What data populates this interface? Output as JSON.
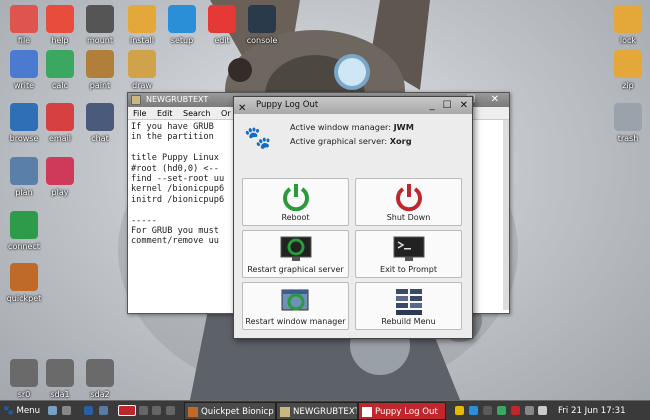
{
  "desktop": {
    "icons": [
      {
        "label": "file",
        "icon": "folder-icon",
        "color": "#e0544f"
      },
      {
        "label": "help",
        "icon": "lifebuoy-icon",
        "color": "#e74c3c"
      },
      {
        "label": "mount",
        "icon": "drive-icon",
        "color": "#555555"
      },
      {
        "label": "install",
        "icon": "box-install-icon",
        "color": "#e4a73a"
      },
      {
        "label": "setup",
        "icon": "gear-icon",
        "color": "#2a8fd6"
      },
      {
        "label": "edit",
        "icon": "lamp-icon",
        "color": "#e53935"
      },
      {
        "label": "console",
        "icon": "terminal-icon",
        "color": "#2b3a4a"
      },
      {
        "label": "lock",
        "icon": "padlock-icon",
        "color": "#e4a73a"
      },
      {
        "label": "write",
        "icon": "pen-icon",
        "color": "#4a7bd0"
      },
      {
        "label": "calc",
        "icon": "spreadsheet-icon",
        "color": "#3aa861"
      },
      {
        "label": "paint",
        "icon": "palette-icon",
        "color": "#b0803a"
      },
      {
        "label": "draw",
        "icon": "drawing-icon",
        "color": "#d0a24a"
      },
      {
        "label": "zip",
        "icon": "archive-icon",
        "color": "#e4a73a"
      },
      {
        "label": "browse",
        "icon": "globe-icon",
        "color": "#2f6fb5"
      },
      {
        "label": "email",
        "icon": "mail-icon",
        "color": "#d64040"
      },
      {
        "label": "chat",
        "icon": "chat-bubble-icon",
        "color": "#4a5a7a"
      },
      {
        "label": "trash",
        "icon": "trash-icon",
        "color": "#9aa3ab"
      },
      {
        "label": "plan",
        "icon": "calendar-icon",
        "color": "#5a7fa8"
      },
      {
        "label": "play",
        "icon": "play-icon",
        "color": "#d03a5a"
      },
      {
        "label": "connect",
        "icon": "antenna-icon",
        "color": "#2e9b4a"
      },
      {
        "label": "quickpet",
        "icon": "dog-icon",
        "color": "#c06a2a"
      },
      {
        "label": "sr0",
        "icon": "optical-drive-icon",
        "color": "#6a6a6a"
      },
      {
        "label": "sda1",
        "icon": "disk-icon",
        "color": "#6a6a6a"
      },
      {
        "label": "sda2",
        "icon": "disk-icon",
        "color": "#6a6a6a"
      }
    ]
  },
  "editor": {
    "title": "NEWGRUBTEXT",
    "menus": [
      "File",
      "Edit",
      "Search",
      "Or"
    ],
    "text": "If you have GRUB                               p6 (us\nin the partition                                ts\n\ntitle Puppy Linux                              cpup6\n#root (hd0,0) <--\nfind --set-root uu\nkernel /bionicpup6                             ionicp\ninitrd /bionicpup6                             p6/in\n\n-----\nFor GRUB you must                              dos..\ncomment/remove uu"
  },
  "dialog": {
    "title": "Puppy Log Out",
    "wm_label": "Active window manager:",
    "wm_value": "JWM",
    "server_label": "Active graphical server:",
    "server_value": "Xorg",
    "buttons": [
      {
        "label": "Reboot",
        "icon": "reboot-icon"
      },
      {
        "label": "Shut Down",
        "icon": "power-off-icon"
      },
      {
        "label": "Restart graphical server",
        "icon": "restart-x-icon"
      },
      {
        "label": "Exit to Prompt",
        "icon": "terminal-prompt-icon"
      },
      {
        "label": "Restart window manager",
        "icon": "restart-wm-icon"
      },
      {
        "label": "Rebuild Menu",
        "icon": "rebuild-menu-icon"
      }
    ]
  },
  "taskbar": {
    "menu_label": "Menu",
    "tasks": [
      {
        "label": "Quickpet Bionicp"
      },
      {
        "label": "NEWGRUBTEXT"
      },
      {
        "label": "Puppy Log Out"
      }
    ],
    "clock": "Fri 21 Jun  17:31"
  }
}
